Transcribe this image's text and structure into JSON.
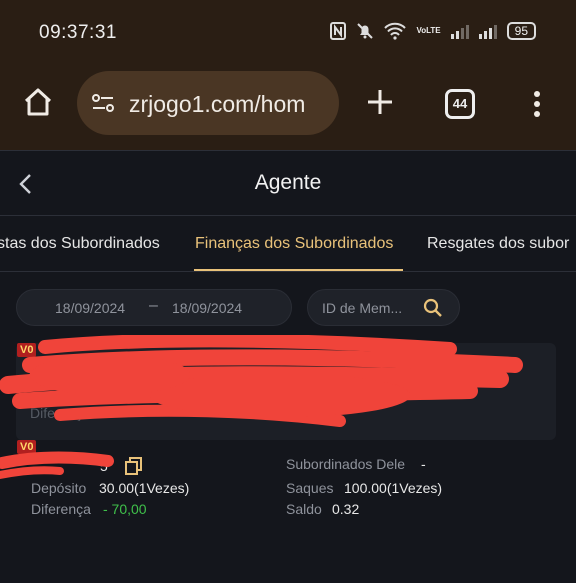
{
  "status_bar": {
    "time": "09:37:31",
    "battery": "95",
    "network_label": "VoLTE"
  },
  "browser": {
    "url": "zrjogo1.com/hom",
    "tab_count": "44"
  },
  "header": {
    "title": "Agente"
  },
  "tabs": [
    {
      "label": "stas dos Subordinados",
      "active": false
    },
    {
      "label": "Finanças dos Subordinados",
      "active": true
    },
    {
      "label": "Resgates dos subor",
      "active": false
    }
  ],
  "filters": {
    "date_from": "18/09/2024",
    "date_separator": "–",
    "date_to": "18/09/2024",
    "member_id_placeholder": "ID de Mem..."
  },
  "cards": [
    {
      "badge": "V0",
      "faded_label": "Diferença"
    },
    {
      "badge": "V0",
      "id_suffix": "5",
      "deposit_label": "Depósito",
      "deposit_value": "30.00(1Vezes)",
      "difference_label": "Diferença",
      "difference_value": "- 70,00",
      "subordinates_label": "Subordinados Dele",
      "subordinates_value": "-",
      "withdrawals_label": "Saques",
      "withdrawals_value": "100.00(1Vezes)",
      "balance_label": "Saldo",
      "balance_value": "0.32"
    }
  ],
  "colors": {
    "accent": "#e9c27a",
    "positive": "#3fc04a",
    "badge_bg": "#b11f1f",
    "redaction": "#f0443a"
  }
}
